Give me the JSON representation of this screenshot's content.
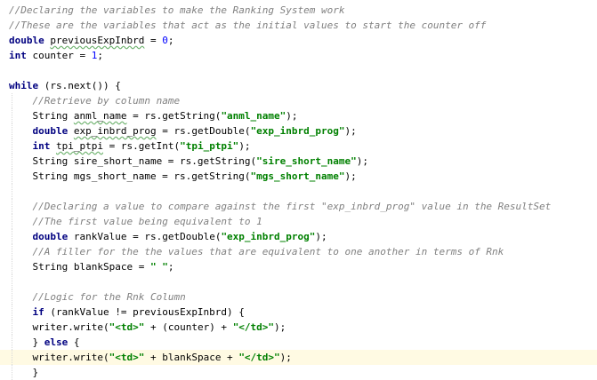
{
  "editor": {
    "current_line": 23,
    "caret": {
      "line": 23,
      "token": 5,
      "offset": 4
    },
    "lines": [
      [
        {
          "t": "//Declaring the variables to make the Ranking System work",
          "k": "comment"
        }
      ],
      [
        {
          "t": "//These are the variables that act as the initial values to start the counter off",
          "k": "comment"
        }
      ],
      [
        {
          "t": "double",
          "k": "keyword"
        },
        {
          "t": " ",
          "k": "plain"
        },
        {
          "t": "previousExpInbrd",
          "k": "plain",
          "typo": true
        },
        {
          "t": " = ",
          "k": "plain"
        },
        {
          "t": "0",
          "k": "number"
        },
        {
          "t": ";",
          "k": "plain"
        }
      ],
      [
        {
          "t": "int",
          "k": "keyword"
        },
        {
          "t": " counter = ",
          "k": "plain"
        },
        {
          "t": "1",
          "k": "number"
        },
        {
          "t": ";",
          "k": "plain"
        }
      ],
      [],
      [
        {
          "t": "while",
          "k": "keyword"
        },
        {
          "t": " (rs.next()) {",
          "k": "plain"
        }
      ],
      [
        {
          "t": "    ",
          "k": "plain"
        },
        {
          "t": "//Retrieve by column name",
          "k": "comment"
        }
      ],
      [
        {
          "t": "    String ",
          "k": "plain"
        },
        {
          "t": "anml_name",
          "k": "plain",
          "typo": true
        },
        {
          "t": " = rs.getString(",
          "k": "plain"
        },
        {
          "t": "\"anml_name\"",
          "k": "string"
        },
        {
          "t": ");",
          "k": "plain"
        }
      ],
      [
        {
          "t": "    ",
          "k": "plain"
        },
        {
          "t": "double",
          "k": "keyword"
        },
        {
          "t": " ",
          "k": "plain"
        },
        {
          "t": "exp_inbrd_prog",
          "k": "plain",
          "typo": true
        },
        {
          "t": " = rs.getDouble(",
          "k": "plain"
        },
        {
          "t": "\"exp_inbrd_prog\"",
          "k": "string"
        },
        {
          "t": ");",
          "k": "plain"
        }
      ],
      [
        {
          "t": "    ",
          "k": "plain"
        },
        {
          "t": "int",
          "k": "keyword"
        },
        {
          "t": " ",
          "k": "plain"
        },
        {
          "t": "tpi_ptpi",
          "k": "plain",
          "typo": true
        },
        {
          "t": " = rs.getInt(",
          "k": "plain"
        },
        {
          "t": "\"tpi_ptpi\"",
          "k": "string"
        },
        {
          "t": ");",
          "k": "plain"
        }
      ],
      [
        {
          "t": "    String sire_short_name = rs.getString(",
          "k": "plain"
        },
        {
          "t": "\"sire_short_name\"",
          "k": "string"
        },
        {
          "t": ");",
          "k": "plain"
        }
      ],
      [
        {
          "t": "    String mgs_short_name = rs.getString(",
          "k": "plain"
        },
        {
          "t": "\"mgs_short_name\"",
          "k": "string"
        },
        {
          "t": ");",
          "k": "plain"
        }
      ],
      [],
      [
        {
          "t": "    ",
          "k": "plain"
        },
        {
          "t": "//Declaring a value to compare against the first \"exp_inbrd_prog\" value in the ResultSet",
          "k": "comment"
        }
      ],
      [
        {
          "t": "    ",
          "k": "plain"
        },
        {
          "t": "//The first value being equivalent to 1",
          "k": "comment"
        }
      ],
      [
        {
          "t": "    ",
          "k": "plain"
        },
        {
          "t": "double",
          "k": "keyword"
        },
        {
          "t": " rankValue = rs.getDouble(",
          "k": "plain"
        },
        {
          "t": "\"exp_inbrd_prog\"",
          "k": "string"
        },
        {
          "t": ");",
          "k": "plain"
        }
      ],
      [
        {
          "t": "    ",
          "k": "plain"
        },
        {
          "t": "//A filler for the the values that are equivalent to one another in terms of Rnk",
          "k": "comment"
        }
      ],
      [
        {
          "t": "    String blankSpace = ",
          "k": "plain"
        },
        {
          "t": "\" \"",
          "k": "string"
        },
        {
          "t": ";",
          "k": "plain"
        }
      ],
      [],
      [
        {
          "t": "    ",
          "k": "plain"
        },
        {
          "t": "//Logic for the Rnk Column",
          "k": "comment"
        }
      ],
      [
        {
          "t": "    ",
          "k": "plain"
        },
        {
          "t": "if",
          "k": "keyword"
        },
        {
          "t": " (rankValue != previousExpInbrd) {",
          "k": "plain"
        }
      ],
      [
        {
          "t": "    writer.write(",
          "k": "plain"
        },
        {
          "t": "\"<td>\"",
          "k": "string"
        },
        {
          "t": " + (counter) + ",
          "k": "plain"
        },
        {
          "t": "\"</td>\"",
          "k": "string"
        },
        {
          "t": ");",
          "k": "plain"
        }
      ],
      [
        {
          "t": "    } ",
          "k": "plain"
        },
        {
          "t": "else",
          "k": "keyword"
        },
        {
          "t": " {",
          "k": "plain"
        }
      ],
      [
        {
          "t": "    writer.write(",
          "k": "plain"
        },
        {
          "t": "\"<td>\"",
          "k": "string"
        },
        {
          "t": " + blankSpace + ",
          "k": "plain"
        },
        {
          "t": "\"</td>\"",
          "k": "string"
        },
        {
          "t": ");",
          "k": "plain"
        }
      ],
      [
        {
          "t": "    }",
          "k": "plain"
        }
      ]
    ]
  }
}
